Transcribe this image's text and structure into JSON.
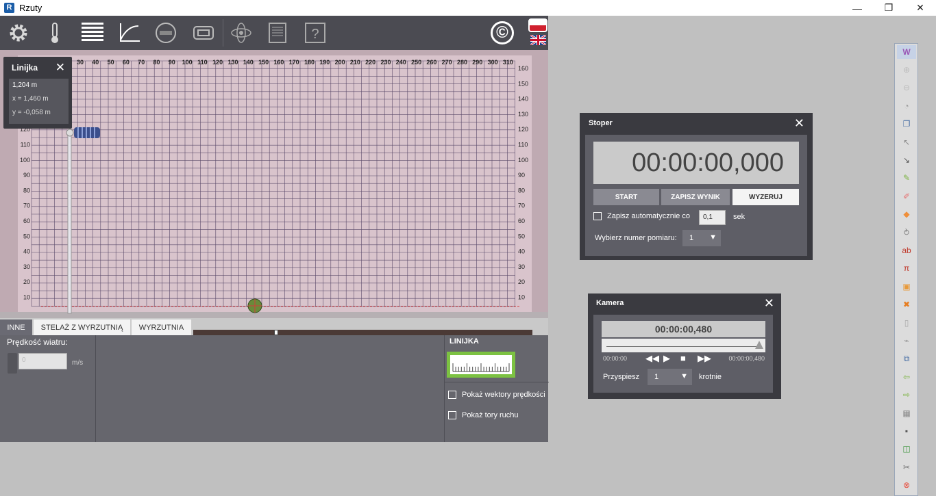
{
  "window": {
    "title": "Rzuty",
    "app_icon": "app-logo-icon"
  },
  "toolbar": {
    "icons": [
      "gear-icon",
      "thermometer-icon",
      "table-icon",
      "graph-icon",
      "stopwatch-icon",
      "camera-icon",
      "atom-icon",
      "book-icon",
      "help-icon"
    ],
    "copyright_symbol": "©",
    "languages": [
      "pl",
      "en"
    ]
  },
  "scene": {
    "top_axis_labels": [
      "30",
      "40",
      "50",
      "60",
      "70",
      "80",
      "90",
      "100",
      "110",
      "120",
      "130",
      "140",
      "150",
      "160",
      "170",
      "180",
      "190",
      "200",
      "210",
      "220",
      "230",
      "240",
      "250",
      "260",
      "270",
      "280",
      "290",
      "300",
      "310"
    ],
    "side_axis_labels": [
      "160",
      "150",
      "140",
      "130",
      "120",
      "110",
      "100",
      "90",
      "80",
      "70",
      "60",
      "50",
      "40",
      "30",
      "20",
      "10"
    ]
  },
  "ruler_panel": {
    "title": "Linijka",
    "length": "1,204 m",
    "x": "x = 1,460 m",
    "y": "y = -0,058 m"
  },
  "tabs": {
    "items": [
      "INNE",
      "STELAŻ Z WYRZUTNIĄ",
      "WYRZUTNIA"
    ],
    "active": 0
  },
  "bottom": {
    "wind_label": "Prędkość wiatru:",
    "wind_value": "0",
    "wind_unit": "m/s",
    "linijka_label": "LINIJKA",
    "show_vectors": "Pokaż wektory prędkości",
    "show_paths": "Pokaż tory ruchu"
  },
  "stoper": {
    "title": "Stoper",
    "display": "00:00:00,000",
    "start": "START",
    "save": "ZAPISZ WYNIK",
    "reset": "WYZERUJ",
    "auto_label": "Zapisz automatycznie co",
    "auto_value": "0,1",
    "auto_unit": "sek",
    "select_label": "Wybierz numer pomiaru:",
    "select_value": "1"
  },
  "kamera": {
    "title": "Kamera",
    "display": "00:00:00,480",
    "time_start": "00:00:00",
    "time_end": "00:00:00,480",
    "speed_label": "Przyspiesz",
    "speed_value": "1",
    "speed_unit": "krotnie"
  },
  "right_toolbar": {
    "top_label": "W",
    "icons": [
      "zoom-in-icon",
      "zoom-out-icon",
      "mouse-icon",
      "copy-icon",
      "pointer-icon",
      "resize-icon",
      "pen-icon",
      "eraser-icon",
      "shapes-icon",
      "lasso-icon",
      "text-icon",
      "formula-icon",
      "image-icon",
      "delete-icon",
      "page-icon",
      "dropper-icon",
      "duplicate-icon",
      "undo-icon",
      "redo-icon",
      "grid-icon",
      "save-icon",
      "screenshot-icon",
      "settings-icon",
      "close-icon"
    ]
  }
}
